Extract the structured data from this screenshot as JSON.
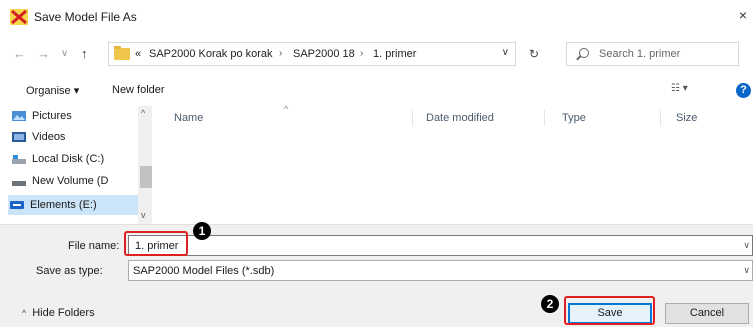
{
  "window": {
    "title": "Save Model File As",
    "close_label": "×"
  },
  "nav": {
    "back": "←",
    "forward": "→",
    "history": "∨",
    "up": "↑",
    "breadcrumb": [
      "«",
      "SAP2000 Korak po korak",
      "SAP2000 18",
      "1. primer"
    ],
    "crumb_sep": "›",
    "dropdown": "∨",
    "refresh": "↻",
    "search_placeholder": "Search 1. primer"
  },
  "toolbar": {
    "organise": "Organise ▾",
    "new_folder": "New folder",
    "view": "☷ ▾",
    "help": "?"
  },
  "navpane": {
    "items": [
      {
        "label": "Pictures",
        "icon": "pictures-icon"
      },
      {
        "label": "Videos",
        "icon": "videos-icon"
      },
      {
        "label": "Local Disk (C:)",
        "icon": "local-disk-icon"
      },
      {
        "label": "New Volume (D",
        "icon": "drive-icon"
      },
      {
        "label": "Elements (E:)",
        "icon": "usb-drive-icon",
        "selected": true
      }
    ],
    "scroll_up": "^",
    "scroll_down": "v"
  },
  "columns": [
    "Name",
    "Date modified",
    "Type",
    "Size"
  ],
  "sort_indicator": "^",
  "form": {
    "file_name_label": "File name:",
    "file_name_value": "1. primer",
    "save_as_type_label": "Save as type:",
    "save_as_type_value": "SAP2000 Model Files (*.sdb)",
    "dropdown": "∨"
  },
  "footer": {
    "hide_folders": "Hide Folders",
    "hide_caret": "^",
    "save": "Save",
    "cancel": "Cancel"
  },
  "annotations": {
    "badge1": "1",
    "badge2": "2"
  },
  "colors": {
    "accent": "#0078d7",
    "highlight": "#e02020",
    "selection": "#cce4f7"
  }
}
